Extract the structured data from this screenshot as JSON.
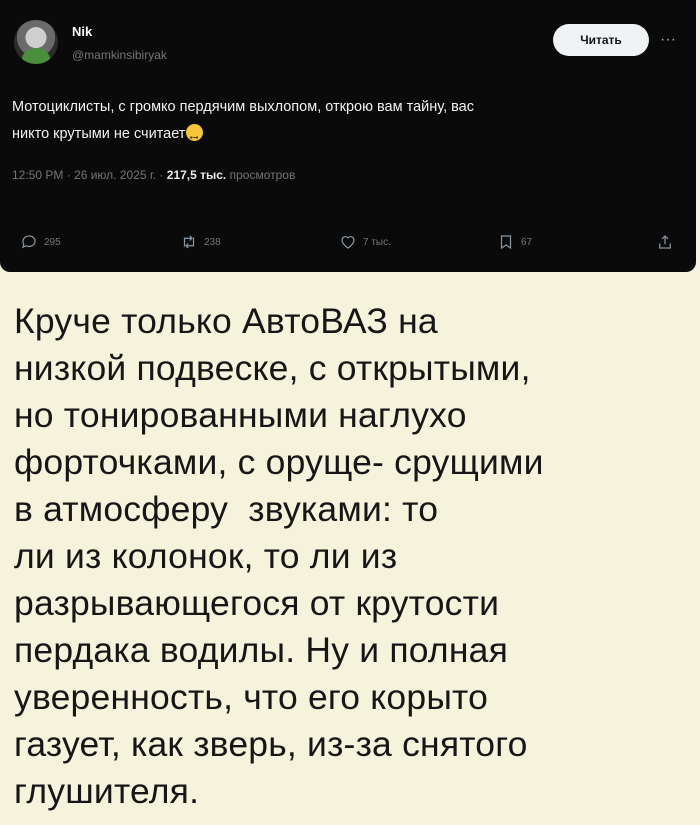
{
  "tweet": {
    "display_name": "Nik",
    "handle": "@mamkinsibiryak",
    "follow_label": "Читать",
    "more_label": "···",
    "text": "Мотоциклисты, с громко пердячим выхлопом, открою вам тайну, вас никто крутыми не считает",
    "text_lines": [
      "Мотоциклисты, с громко пердячим выхлопом, открою вам тайну, вас",
      "никто крутыми не считает"
    ],
    "emoji": "smiling-face-emoji",
    "meta_time": "12:50 PM · 26 июл. 2025 г. · ",
    "meta_views": "217,5 тыс.",
    "meta_views_label": " просмотров",
    "actions": {
      "replies": "295",
      "reposts": "238",
      "likes": "7 тыс.",
      "bookmarks": "67"
    },
    "icons": [
      "reply-icon",
      "repost-icon",
      "like-icon",
      "bookmark-icon",
      "share-icon"
    ]
  },
  "comment": {
    "lines": [
      "Круче только АвтоВАЗ на",
      "низкой подвеске, с открытыми,",
      "но тонированными наглухо",
      "форточками, с оруще- срущими",
      "в атмосферу  звуками: то",
      "ли из колонок, то ли из",
      "разрывающегося от крутости",
      "пердака водилы. Ну и полная",
      "уверенность, что его корыто",
      "газует, как зверь, из-за снятого",
      "глушителя."
    ]
  },
  "colors": {
    "page_background": "#f6f3dd",
    "tweet_background": "#0a0a0a",
    "comment_text": "#161616"
  }
}
